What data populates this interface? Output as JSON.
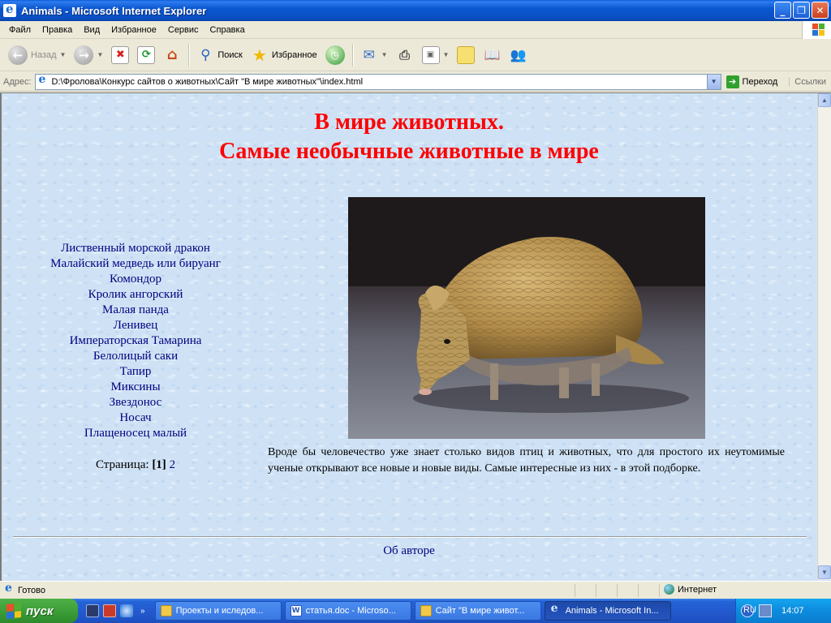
{
  "window": {
    "title": "Animals - Microsoft Internet Explorer",
    "buttons": {
      "minimize": "_",
      "maximize": "❐",
      "close": "✕"
    }
  },
  "menu": [
    "Файл",
    "Правка",
    "Вид",
    "Избранное",
    "Сервис",
    "Справка"
  ],
  "toolbar": {
    "back_label": "Назад",
    "search_label": "Поиск",
    "favorites_label": "Избранное"
  },
  "address": {
    "label": "Адрес:",
    "value": "D:\\Фролова\\Конкурс сайтов о животных\\Сайт \"В мире животных\"\\index.html",
    "go_label": "Переход",
    "links_label": "Ссылки"
  },
  "page": {
    "title_line1": "В мире животных.",
    "title_line2": "Самые необычные животные в мире",
    "nav": [
      "Лиственный морской дракон",
      "Малайский медведь или бируанг",
      "Комондор",
      "Кролик ангорский",
      "Малая панда",
      "Ленивец",
      "Императорская Тамарина",
      "Белолицый саки",
      "Тапир",
      "Миксины",
      "Звездонос",
      "Носач",
      "Плащеносец малый"
    ],
    "pager": {
      "label": "Страница:",
      "current": "[1]",
      "next": "2"
    },
    "article": "Вроде бы человечество уже знает столько видов птиц и животных, что для простого их неутомимые ученые открывают все новые и новые виды. Самые интересные из них - в этой подборке.",
    "about_link": "Об авторе"
  },
  "statusbar": {
    "text": "Готово",
    "zone": "Интернет"
  },
  "taskbar": {
    "start_label": "пуск",
    "tasks": [
      "Проекты и иследов...",
      "статья.doc - Microso...",
      "Сайт \"В мире живот...",
      "Animals - Microsoft In..."
    ],
    "language": "RU",
    "clock": "14:07"
  },
  "colors": {
    "title_red": "#ff0000",
    "link_navy": "#000080",
    "page_bg": "#cfe2f5"
  }
}
